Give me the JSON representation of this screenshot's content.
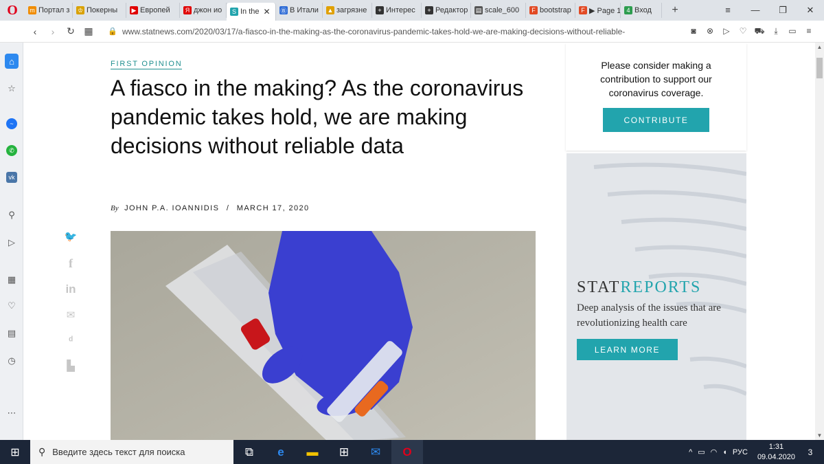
{
  "browser": {
    "tabs": [
      {
        "label": "Портал з",
        "color": "#f08c00",
        "glyph": "m"
      },
      {
        "label": "Покерны",
        "color": "#d9a100",
        "glyph": "♔"
      },
      {
        "label": "Европей",
        "color": "#e00000",
        "glyph": "▶"
      },
      {
        "label": "джон ио",
        "color": "#e00000",
        "glyph": "Я"
      },
      {
        "label": "In the",
        "color": "#22a4ad",
        "glyph": "S",
        "active": true
      },
      {
        "label": "В Итали",
        "color": "#2d6bd6",
        "glyph": "Ⓑ"
      },
      {
        "label": "загрязне",
        "color": "#e0a000",
        "glyph": "▲"
      },
      {
        "label": "Интерес",
        "color": "#333333",
        "glyph": "+"
      },
      {
        "label": "Редактор",
        "color": "#333333",
        "glyph": "+"
      },
      {
        "label": "scale_600",
        "color": "#555555",
        "glyph": "▤"
      },
      {
        "label": "bootstrap",
        "color": "#e24a24",
        "glyph": "F"
      },
      {
        "label": "▶ Page 1",
        "color": "#e24a24",
        "glyph": "F"
      },
      {
        "label": "Вход",
        "color": "#2e9d4f",
        "glyph": "4"
      }
    ],
    "url": "www.statnews.com/2020/03/17/a-fiasco-in-the-making-as-the-coronavirus-pandemic-takes-hold-we-are-making-decisions-without-reliable-"
  },
  "article": {
    "kicker": "FIRST OPINION",
    "headline": "A fiasco in the making? As the coronavirus pandemic takes hold, we are making decisions without reliable data",
    "by": "By",
    "author": "JOHN P.A. IOANNIDIS",
    "separator": "/",
    "date": "MARCH 17, 2020"
  },
  "share_icons": [
    "twitter-icon",
    "facebook-icon",
    "linkedin-icon",
    "email-icon",
    "reddit-icon",
    "print-icon"
  ],
  "promo": {
    "text": "Please consider making a contribution to support our coronavirus coverage.",
    "button": "CONTRIBUTE"
  },
  "stat_reports": {
    "logo_a": "STAT",
    "logo_b": "REPORTS",
    "desc": "Deep analysis of the issues that are revolutionizing health care",
    "button": "LEARN MORE"
  },
  "taskbar": {
    "search_placeholder": "Введите здесь текст для поиска",
    "lang": "РУС",
    "time": "1:31",
    "date": "09.04.2020",
    "notifications": "3"
  },
  "colors": {
    "accent": "#22a4ad",
    "kicker": "#1f8f8f",
    "glove": "#3a3fd0"
  }
}
